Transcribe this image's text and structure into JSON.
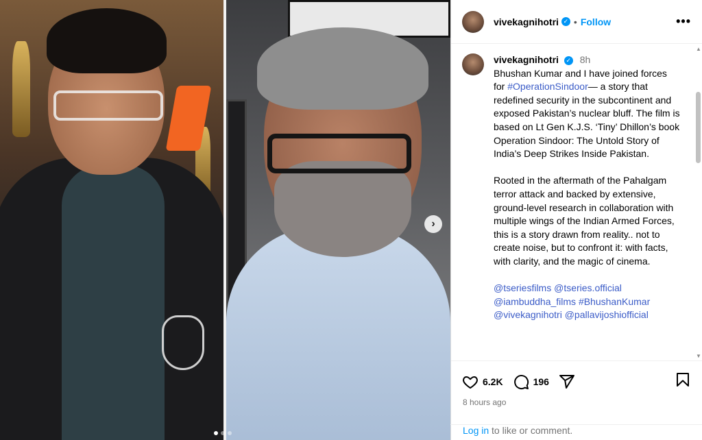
{
  "author": {
    "username": "vivekagnihotri",
    "follow_label": "Follow",
    "separator": "•",
    "more_label": "•••"
  },
  "caption": {
    "username": "vivekagnihotri",
    "time": "8h",
    "para1_part1": "Bhushan Kumar and I have joined forces for ",
    "para1_tag": "#OperationSindoor",
    "para1_part2": "— a story that redefined security in the subcontinent and exposed Pakistan’s nuclear bluff. The film is based on Lt Gen K.J.S. ‘Tiny’ Dhillon’s book Operation Sindoor: The Untold Story of India’s Deep Strikes Inside Pakistan.",
    "para2": "Rooted in the aftermath of the Pahalgam terror attack and backed by extensive, ground-level research in collaboration with multiple wings of the Indian Armed Forces, this is a story drawn from reality.. not to create noise, but to confront it: with facts, with clarity, and the magic of cinema.",
    "tags": [
      "@tseriesfilms",
      "@tseries.official",
      "@iambuddha_films",
      "#BhushanKumar",
      "@vivekagnihotri",
      "@pallavijoshiofficial"
    ]
  },
  "actions": {
    "likes": "6.2K",
    "comments": "196"
  },
  "post_time": "8 hours ago",
  "login": {
    "link": "Log in",
    "rest": " to like or comment."
  },
  "carousel": {
    "active_index": 0,
    "total": 3
  },
  "colors": {
    "accent": "#0095f6",
    "hashtag": "#3a5bc7",
    "muted": "#737373"
  }
}
